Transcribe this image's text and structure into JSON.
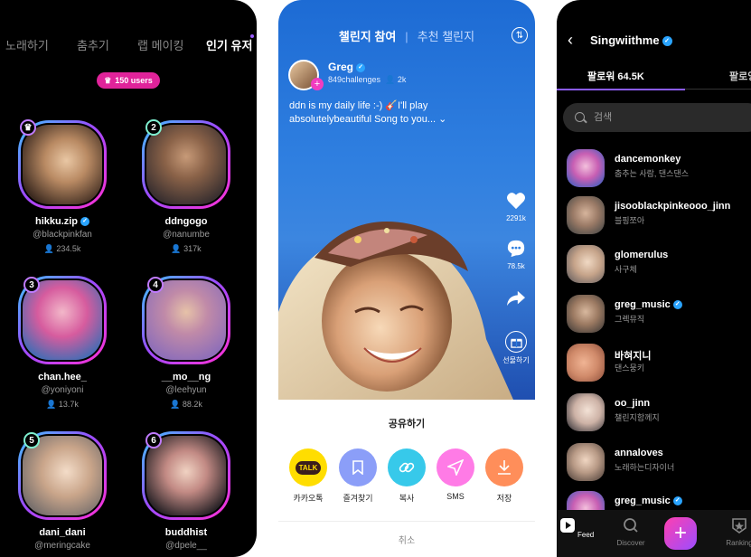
{
  "screen1": {
    "tabs": [
      "노래하기",
      "춤추기",
      "랩 메이킹",
      "인기 유저"
    ],
    "badge": "150 users",
    "users": [
      {
        "rank": "♛",
        "name": "hikku.zip",
        "verified": true,
        "handle": "@blackpinkfan",
        "followers": "234.5k"
      },
      {
        "rank": "2",
        "name": "ddngogo",
        "verified": false,
        "handle": "@nanumbe",
        "followers": "317k"
      },
      {
        "rank": "3",
        "name": "chan.hee_",
        "verified": false,
        "handle": "@yoniyoni",
        "followers": "13.7k"
      },
      {
        "rank": "4",
        "name": "__mo__ng",
        "verified": false,
        "handle": "@leehyun",
        "followers": "88.2k"
      },
      {
        "rank": "5",
        "name": "dani_dani",
        "verified": false,
        "handle": "@meringcake",
        "followers": ""
      },
      {
        "rank": "6",
        "name": "buddhist",
        "verified": false,
        "handle": "@dpele__",
        "followers": ""
      }
    ]
  },
  "screen2": {
    "header_active": "챌린지 참여",
    "header_other": "추천 챌린지",
    "user_name": "Greg",
    "challenges": "849challenges",
    "followers": "2k",
    "caption": "ddn is my daily life :-) 🎸I'll play absolutelybeautiful Song to you... ⌄",
    "likes": "2291k",
    "comments": "78.5k",
    "gift_label": "선물하기",
    "share_title": "공유하기",
    "share_buttons": [
      "카카오톡",
      "즐겨찾기",
      "복사",
      "SMS",
      "저장"
    ],
    "kakao_text": "TALK",
    "cancel": "취소"
  },
  "screen3": {
    "title": "Singwiithme",
    "tab_followers": "팔로워 64.5K",
    "tab_following": "팔로잉",
    "search_placeholder": "검색",
    "followers": [
      {
        "name": "dancemonkey",
        "desc": "춤추는 사람, 댄스댄스",
        "verified": false
      },
      {
        "name": "jisooblackpinkeooo_jinn",
        "desc": "블핑쪼아",
        "verified": false
      },
      {
        "name": "glomerulus",
        "desc": "사구체",
        "verified": false
      },
      {
        "name": "greg_music",
        "desc": "그렉뮤직",
        "verified": true
      },
      {
        "name": "바혀지니",
        "desc": "댄스뭉키",
        "verified": false
      },
      {
        "name": "oo_jinn",
        "desc": "챌린지함께지",
        "verified": false
      },
      {
        "name": "annaloves",
        "desc": "노래하는디자이너",
        "verified": false
      },
      {
        "name": "greg_music",
        "desc": "",
        "verified": true
      }
    ],
    "nav": [
      "Feed",
      "Discover",
      "Ranking"
    ]
  },
  "colors": {
    "accent_purple": "#8b5cf6",
    "accent_pink": "#e0239a",
    "verify_blue": "#2aa4ff"
  }
}
